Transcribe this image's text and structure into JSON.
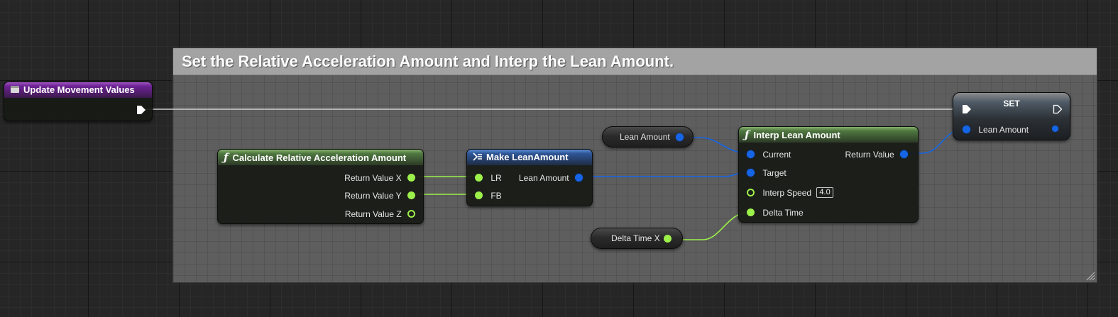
{
  "comment": {
    "title": "Set the Relative Acceleration Amount and Interp the Lean Amount."
  },
  "event_node": {
    "title": "Update Movement Values"
  },
  "calc_node": {
    "title": "Calculate Relative Acceleration Amount",
    "outputs": [
      "Return Value X",
      "Return Value Y",
      "Return Value Z"
    ]
  },
  "make_node": {
    "title": "Make LeanAmount",
    "inputs": [
      "LR",
      "FB"
    ],
    "output": "Lean Amount"
  },
  "lean_var": {
    "label": "Lean Amount"
  },
  "delta_var": {
    "label": "Delta Time X"
  },
  "interp_node": {
    "title": "Interp Lean Amount",
    "inputs": [
      "Current",
      "Target",
      "Interp Speed",
      "Delta Time"
    ],
    "interp_speed_value": "4.0",
    "output": "Return Value"
  },
  "set_node": {
    "title": "SET",
    "pin": "Lean Amount"
  },
  "colors": {
    "exec_wire": "#cfcfcf",
    "float_pin": "#9cf14a",
    "struct_pin": "#1565e6",
    "comment_bg": "#5e5e5e",
    "comment_header": "#a3a3a3"
  },
  "icons": [
    "event-icon",
    "function-icon",
    "struct-make-icon",
    "exec-pin-icon",
    "resize-grip-icon"
  ]
}
